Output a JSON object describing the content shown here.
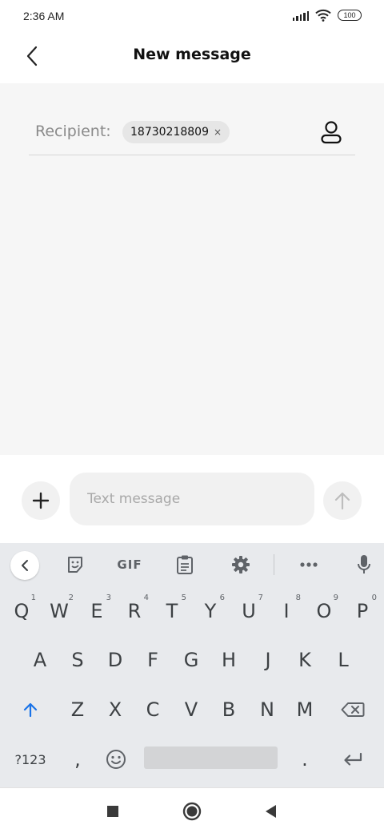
{
  "status_bar": {
    "time": "2:36 AM",
    "battery": "100"
  },
  "header": {
    "title": "New message"
  },
  "recipient": {
    "label": "Recipient:",
    "chips": [
      "18730218809"
    ],
    "chip_remove": "×"
  },
  "compose": {
    "placeholder": "Text message",
    "value": ""
  },
  "keyboard": {
    "toolbar": {
      "gif_label": "GIF"
    },
    "row1": [
      {
        "key": "Q",
        "hint": "1"
      },
      {
        "key": "W",
        "hint": "2"
      },
      {
        "key": "E",
        "hint": "3"
      },
      {
        "key": "R",
        "hint": "4"
      },
      {
        "key": "T",
        "hint": "5"
      },
      {
        "key": "Y",
        "hint": "6"
      },
      {
        "key": "U",
        "hint": "7"
      },
      {
        "key": "I",
        "hint": "8"
      },
      {
        "key": "O",
        "hint": "9"
      },
      {
        "key": "P",
        "hint": "0"
      }
    ],
    "row2": [
      "A",
      "S",
      "D",
      "F",
      "G",
      "H",
      "J",
      "K",
      "L"
    ],
    "row3": [
      "Z",
      "X",
      "C",
      "V",
      "B",
      "N",
      "M"
    ],
    "row4": {
      "symbols": "?123",
      "comma": ",",
      "period": "."
    }
  },
  "colors": {
    "accent": "#1a73e8",
    "content_bg": "#f6f6f6",
    "keyboard_bg": "#e8eaed"
  }
}
